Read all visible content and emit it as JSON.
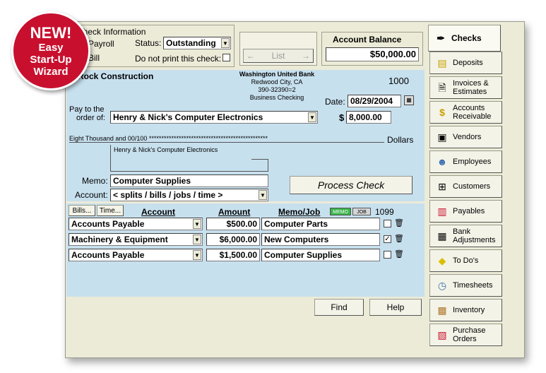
{
  "badge": {
    "line1": "NEW!",
    "line2": "Easy",
    "line3": "Start-Up",
    "line4": "Wizard"
  },
  "check_info": {
    "title": "Check Information",
    "payroll": "Payroll",
    "status_label": "Status:",
    "status_value": "Outstanding",
    "bill_label": "Bill",
    "no_print_label": "Do not print this check:"
  },
  "nav": {
    "list": "List"
  },
  "balance": {
    "label": "Account Balance",
    "value": "$50,000.00"
  },
  "check": {
    "company": "Rock Construction",
    "bank_name": "Washington United Bank",
    "bank_city": "Redwood City, CA",
    "bank_routing": "390-32390=2",
    "bank_type": "Business Checking",
    "number": "1000",
    "date_label": "Date:",
    "date_value": "08/29/2004",
    "pay_to_label1": "Pay to the",
    "pay_to_label2": "order of:",
    "payee": "Henry & Nick's Computer Electronics",
    "dollar_sign": "$",
    "amount": "8,000.00",
    "amount_words": "Eight Thousand and 00/100 ************************************************",
    "dollars_label": "Dollars",
    "address": "Henry & Nick's Computer Electronics",
    "memo_label": "Memo:",
    "memo_value": "Computer Supplies",
    "account_label": "Account:",
    "account_value": "< splits / bills / jobs / time >",
    "process_button": "Process Check"
  },
  "splits": {
    "bills_button": "Bills...",
    "time_button": "Time...",
    "col_account": "Account",
    "col_amount": "Amount",
    "col_memo_job": "Memo/Job",
    "memo_toggle": "MEMO",
    "job_toggle": "JOB",
    "col_1099": "1099",
    "rows": [
      {
        "account": "Accounts Payable",
        "amount": "$500.00",
        "memo": "Computer Parts",
        "is1099": ""
      },
      {
        "account": "Machinery & Equipment",
        "amount": "$6,000.00",
        "memo": "New Computers",
        "is1099": "✓"
      },
      {
        "account": "Accounts Payable",
        "amount": "$1,500.00",
        "memo": "Computer Supplies",
        "is1099": ""
      }
    ]
  },
  "footer": {
    "find": "Find",
    "help": "Help"
  },
  "tabs": [
    {
      "label": "Checks",
      "icon": "pen-icon"
    },
    {
      "label": "Deposits",
      "icon": "deposit-icon"
    },
    {
      "label": "Invoices & Estimates",
      "icon": "invoice-icon"
    },
    {
      "label": "Accounts Receivable",
      "icon": "money-icon"
    },
    {
      "label": "Vendors",
      "icon": "register-icon"
    },
    {
      "label": "Employees",
      "icon": "people-icon"
    },
    {
      "label": "Customers",
      "icon": "cart-icon"
    },
    {
      "label": "Payables",
      "icon": "bill-icon"
    },
    {
      "label": "Bank Adjustments",
      "icon": "safe-icon"
    },
    {
      "label": "To Do's",
      "icon": "note-icon"
    },
    {
      "label": "Timesheets",
      "icon": "clock-icon"
    },
    {
      "label": "Inventory",
      "icon": "box-icon"
    },
    {
      "label": "Purchase Orders",
      "icon": "po-icon"
    }
  ]
}
